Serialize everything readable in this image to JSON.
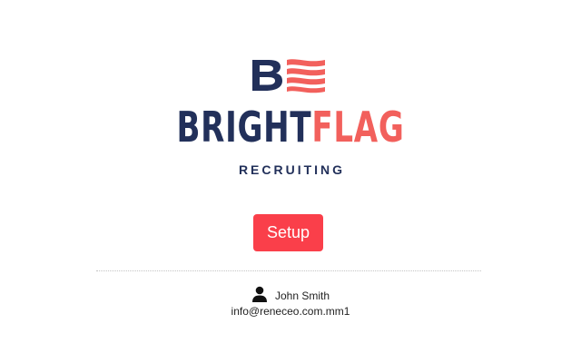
{
  "brand": {
    "name_part1": "BRIGHT",
    "name_part2": "FLAG",
    "tagline": "RECRUITING",
    "logo_icon": "brightflag-logo-icon",
    "colors": {
      "navy": "#22305a",
      "coral": "#f2605c"
    }
  },
  "actions": {
    "setup_label": "Setup",
    "setup_color": "#fa3f4a"
  },
  "user": {
    "icon": "user-icon",
    "name": "John Smith",
    "email": "info@reneceo.com.mm1"
  }
}
